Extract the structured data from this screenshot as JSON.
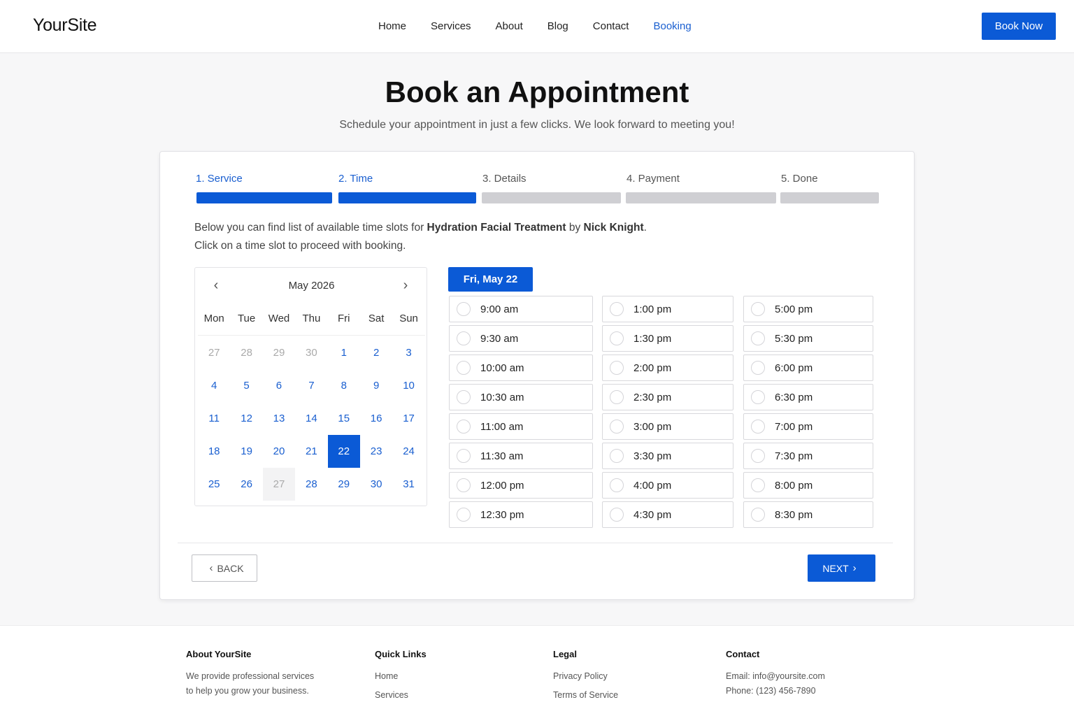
{
  "header": {
    "logo": "YourSite",
    "nav": [
      "Home",
      "Services",
      "About",
      "Blog",
      "Contact",
      "Booking"
    ],
    "active_nav": "Booking",
    "cta": "Book Now"
  },
  "hero": {
    "title": "Book an Appointment",
    "subtitle": "Schedule your appointment in just a few clicks. We look forward to meeting you!"
  },
  "steps": [
    {
      "label": "1. Service",
      "active": true
    },
    {
      "label": "2. Time",
      "active": true
    },
    {
      "label": "3. Details",
      "active": false
    },
    {
      "label": "4. Payment",
      "active": false
    },
    {
      "label": "5. Done",
      "active": false
    }
  ],
  "intro": {
    "prefix": "Below you can find list of available time slots for ",
    "service": "Hydration Facial Treatment",
    "by": " by ",
    "staff": "Nick Knight",
    "suffix": ".",
    "line2": "Click on a time slot to proceed with booking."
  },
  "calendar": {
    "month_label": "May 2026",
    "prev_icon": "chevron-left-icon",
    "next_icon": "chevron-right-icon",
    "weekdays": [
      "Mon",
      "Tue",
      "Wed",
      "Thu",
      "Fri",
      "Sat",
      "Sun"
    ],
    "days": [
      {
        "d": "27",
        "state": "muted"
      },
      {
        "d": "28",
        "state": "muted"
      },
      {
        "d": "29",
        "state": "muted"
      },
      {
        "d": "30",
        "state": "muted"
      },
      {
        "d": "1",
        "state": "available"
      },
      {
        "d": "2",
        "state": "available"
      },
      {
        "d": "3",
        "state": "available"
      },
      {
        "d": "4",
        "state": "available"
      },
      {
        "d": "5",
        "state": "available"
      },
      {
        "d": "6",
        "state": "available"
      },
      {
        "d": "7",
        "state": "available"
      },
      {
        "d": "8",
        "state": "available"
      },
      {
        "d": "9",
        "state": "available"
      },
      {
        "d": "10",
        "state": "available"
      },
      {
        "d": "11",
        "state": "available"
      },
      {
        "d": "12",
        "state": "available"
      },
      {
        "d": "13",
        "state": "available"
      },
      {
        "d": "14",
        "state": "available"
      },
      {
        "d": "15",
        "state": "available"
      },
      {
        "d": "16",
        "state": "available"
      },
      {
        "d": "17",
        "state": "available"
      },
      {
        "d": "18",
        "state": "available"
      },
      {
        "d": "19",
        "state": "available"
      },
      {
        "d": "20",
        "state": "available"
      },
      {
        "d": "21",
        "state": "available"
      },
      {
        "d": "22",
        "state": "selected"
      },
      {
        "d": "23",
        "state": "available"
      },
      {
        "d": "24",
        "state": "available"
      },
      {
        "d": "25",
        "state": "available"
      },
      {
        "d": "26",
        "state": "available"
      },
      {
        "d": "27",
        "state": "disabled"
      },
      {
        "d": "28",
        "state": "available"
      },
      {
        "d": "29",
        "state": "available"
      },
      {
        "d": "30",
        "state": "available"
      },
      {
        "d": "31",
        "state": "available"
      }
    ]
  },
  "slots": {
    "date_label": "Fri, May 22",
    "columns": [
      [
        "9:00 am",
        "9:30 am",
        "10:00 am",
        "10:30 am",
        "11:00 am",
        "11:30 am",
        "12:00 pm",
        "12:30 pm"
      ],
      [
        "1:00 pm",
        "1:30 pm",
        "2:00 pm",
        "2:30 pm",
        "3:00 pm",
        "3:30 pm",
        "4:00 pm",
        "4:30 pm"
      ],
      [
        "5:00 pm",
        "5:30 pm",
        "6:00 pm",
        "6:30 pm",
        "7:00 pm",
        "7:30 pm",
        "8:00 pm",
        "8:30 pm"
      ]
    ]
  },
  "actions": {
    "back": "BACK",
    "next": "NEXT"
  },
  "footer": {
    "about": {
      "title": "About YourSite",
      "lines": [
        "We provide professional services",
        "to help you grow your business."
      ]
    },
    "quick_links": {
      "title": "Quick Links",
      "links": [
        "Home",
        "Services"
      ]
    },
    "legal": {
      "title": "Legal",
      "links": [
        "Privacy Policy",
        "Terms of Service"
      ]
    },
    "contact": {
      "title": "Contact",
      "lines": [
        "Email: info@yoursite.com",
        "Phone: (123) 456-7890"
      ]
    }
  },
  "colors": {
    "accent": "#0b5ad6",
    "link": "#1a5fd0",
    "inactive_step": "#cfcfd3"
  }
}
